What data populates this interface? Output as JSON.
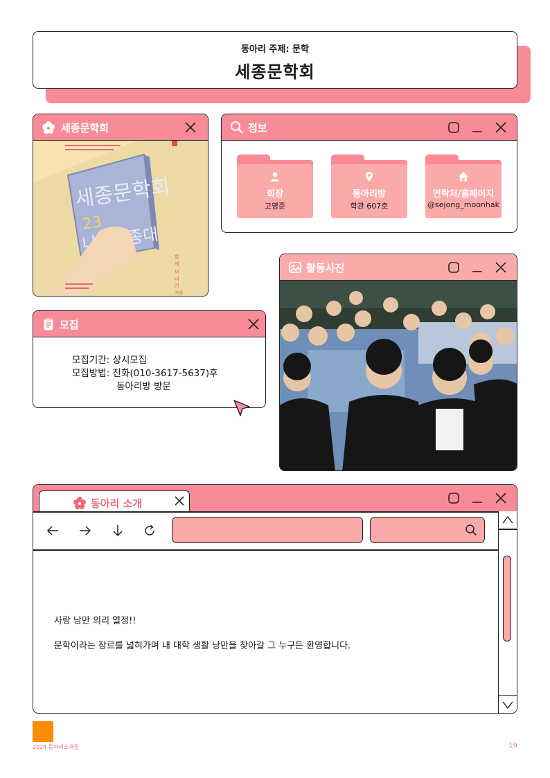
{
  "header": {
    "subtitle": "동아리 주제: 문학",
    "title": "세종문학회"
  },
  "poster_window": {
    "title": "세종문학회",
    "icon": "flower-icon",
    "poster_headline": "세종문학회 23 나의세종대",
    "poster_vertical": "함께 써 내려 가요"
  },
  "info_window": {
    "title": "정보",
    "icon": "search-icon",
    "folders": [
      {
        "icon": "person-icon",
        "title": "회장",
        "value": "고영준"
      },
      {
        "icon": "location-pin-icon",
        "title": "동아리방",
        "value": "학관 607호"
      },
      {
        "icon": "home-icon",
        "title": "연락처/홈페이지",
        "value": "@sejong_moonhak"
      }
    ]
  },
  "photo_window": {
    "title": "활동사진",
    "icon": "image-icon"
  },
  "recruit_window": {
    "title": "모집",
    "icon": "clipboard-icon",
    "period_label": "모집기간:",
    "period_value": "상시모집",
    "method_label": "모집방법:",
    "method_value_1": "전화(010-3617-5637)후",
    "method_value_2": "동아리방 방문"
  },
  "browser_window": {
    "tab_label": "동아리 소개",
    "tab_icon": "flower-icon",
    "line1": "사랑 낭만 의리 열정!!",
    "line2": "문학이라는 장르를 넓혀가며 내 대학 생활 낭만을 찾아갈 그 누구든 환영합니다."
  },
  "footer": {
    "text": "2024 동아리소개집",
    "page": "19"
  },
  "colors": {
    "accent": "#f98a98",
    "accent_light": "#fbaaaa",
    "text_pink": "#f06a7e",
    "orange": "#ff8c00"
  }
}
